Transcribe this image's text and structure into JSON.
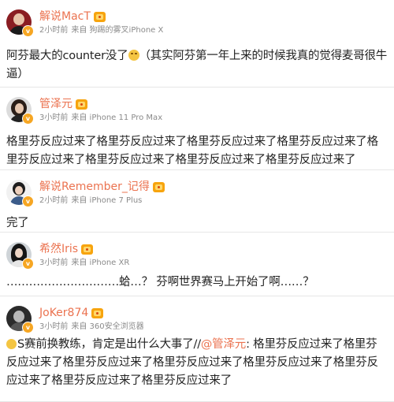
{
  "posts": [
    {
      "name": "解说MacT",
      "time": "2小时前",
      "source": "来自 狗踢的雾叉iPhone X",
      "text": "阿芬最大的counter没了",
      "text_after_emoji": "（其实阿芬第一年上来的时候我真的觉得麦哥很牛逼）"
    },
    {
      "name": "管泽元",
      "time": "3小时前",
      "source": "来自 iPhone 11 Pro Max",
      "text": "格里芬反应过来了格里芬反应过来了格里芬反应过来了格里芬反应过来了格里芬反应过来了格里芬反应过来了格里芬反应过来了格里芬反应过来了"
    },
    {
      "name": "解说Remember_记得",
      "time": "2小时前",
      "source": "来自 iPhone 7 Plus",
      "text": "完了"
    },
    {
      "name": "希然Iris",
      "time": "3小时前",
      "source": "来自 iPhone XR",
      "text": "…………………………蛤…？ 芬啊世界赛马上开始了啊……？"
    },
    {
      "name": "JoKer874",
      "time": "3小时前",
      "source": "来自 360安全浏览器",
      "text_before": "S赛前换教练，肯定是出什么大事了//",
      "mention": "@管泽元",
      "text_after": ": 格里芬反应过来了格里芬反应过来了格里芬反应过来了格里芬反应过来了格里芬反应过来了格里芬反应过来了格里芬反应过来了格里芬反应过来了"
    }
  ]
}
